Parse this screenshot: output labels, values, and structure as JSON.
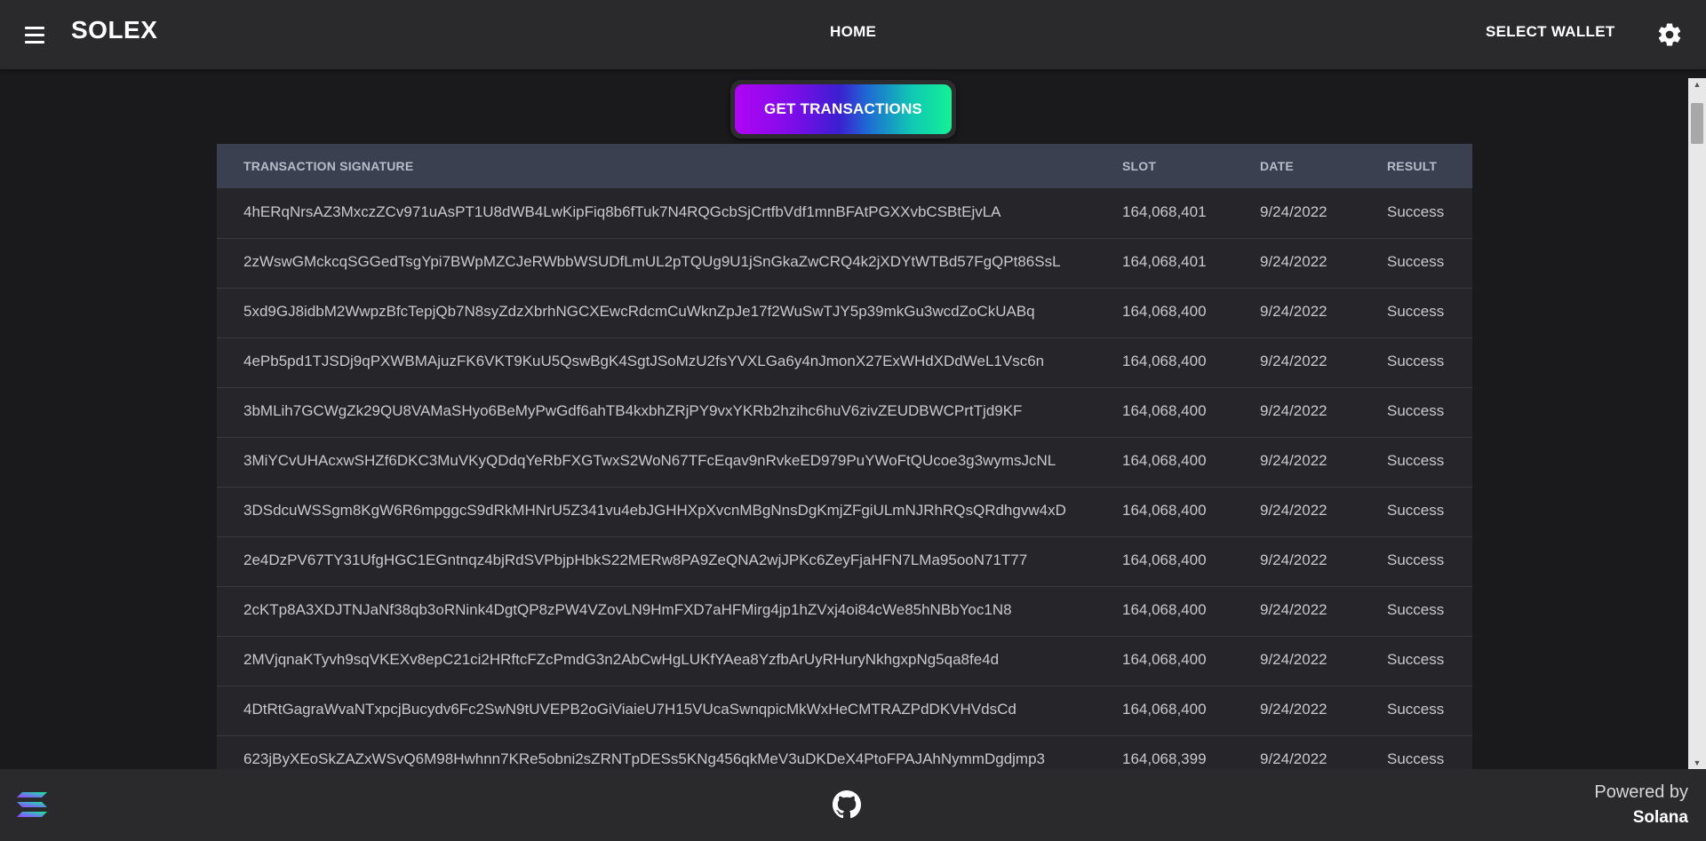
{
  "header": {
    "brand": "SOLEX",
    "nav_home": "HOME",
    "wallet_label": "SELECT WALLET",
    "menu_icon": "hamburger-menu-icon",
    "settings_icon": "gear-icon"
  },
  "main": {
    "get_transactions_label": "GET TRANSACTIONS",
    "table": {
      "columns": [
        "TRANSACTION SIGNATURE",
        "SLOT",
        "DATE",
        "RESULT"
      ],
      "rows": [
        [
          "4hERqNrsAZ3MxczZCv971uAsPT1U8dWB4LwKipFiq8b6fTuk7N4RQGcbSjCrtfbVdf1mnBFAtPGXXvbCSBtEjvLA",
          "164,068,401",
          "9/24/2022",
          "Success"
        ],
        [
          "2zWswGMckcqSGGedTsgYpi7BWpMZCJeRWbbWSUDfLmUL2pTQUg9U1jSnGkaZwCRQ4k2jXDYtWTBd57FgQPt86SsL",
          "164,068,401",
          "9/24/2022",
          "Success"
        ],
        [
          "5xd9GJ8idbM2WwpzBfcTepjQb7N8syZdzXbrhNGCXEwcRdcmCuWknZpJe17f2WuSwTJY5p39mkGu3wcdZoCkUABq",
          "164,068,400",
          "9/24/2022",
          "Success"
        ],
        [
          "4ePb5pd1TJSDj9qPXWBMAjuzFK6VKT9KuU5QswBgK4SgtJSoMzU2fsYVXLGa6y4nJmonX27ExWHdXDdWeL1Vsc6n",
          "164,068,400",
          "9/24/2022",
          "Success"
        ],
        [
          "3bMLih7GCWgZk29QU8VAMaSHyo6BeMyPwGdf6ahTB4kxbhZRjPY9vxYKRb2hzihc6huV6zivZEUDBWCPrtTjd9KF",
          "164,068,400",
          "9/24/2022",
          "Success"
        ],
        [
          "3MiYCvUHAcxwSHZf6DKC3MuVKyQDdqYeRbFXGTwxS2WoN67TFcEqav9nRvkeED979PuYWoFtQUcoe3g3wymsJcNL",
          "164,068,400",
          "9/24/2022",
          "Success"
        ],
        [
          "3DSdcuWSSgm8KgW6R6mpggcS9dRkMHNrU5Z341vu4ebJGHHXpXvcnMBgNnsDgKmjZFgiULmNJRhRQsQRdhgvw4xD",
          "164,068,400",
          "9/24/2022",
          "Success"
        ],
        [
          "2e4DzPV67TY31UfgHGC1EGntnqz4bjRdSVPbjpHbkS22MERw8PA9ZeQNA2wjJPKc6ZeyFjaHFN7LMa95ooN71T77",
          "164,068,400",
          "9/24/2022",
          "Success"
        ],
        [
          "2cKTp8A3XDJTNJaNf38qb3oRNink4DgtQP8zPW4VZovLN9HmFXD7aHFMirg4jp1hZVxj4oi84cWe85hNBbYoc1N8",
          "164,068,400",
          "9/24/2022",
          "Success"
        ],
        [
          "2MVjqnaKTyvh9sqVKEXv8epC21ci2HRftcFZcPmdG3n2AbCwHgLUKfYAea8YzfbArUyRHuryNkhgxpNg5qa8fe4d",
          "164,068,400",
          "9/24/2022",
          "Success"
        ],
        [
          "4DtRtGagraWvaNTxpcjBucydv6Fc2SwN9tUVEPB2oGiViaieU7H15VUcaSwnqpicMkWxHeCMTRAZPdDKVHVdsCd",
          "164,068,400",
          "9/24/2022",
          "Success"
        ],
        [
          "623jByXEoSkZAZxWSvQ6M98Hwhnn7KRe5obni2sZRNTpDESs5KNg456qkMeV3uDKDeX4PtoFPAJAhNymmDgdjmp3",
          "164,068,399",
          "9/24/2022",
          "Success"
        ]
      ]
    }
  },
  "footer": {
    "logo_icon": "solana-logo-icon",
    "github_icon": "github-icon",
    "powered_by": "Powered by",
    "powered_name": "Solana"
  },
  "colors": {
    "header_bg": "#2a2a2d",
    "page_bg": "#1a1a1c",
    "table_bg": "#26262a",
    "table_header_bg": "#3a4050",
    "gradient_start": "#b105f4",
    "gradient_end": "#14f195"
  }
}
